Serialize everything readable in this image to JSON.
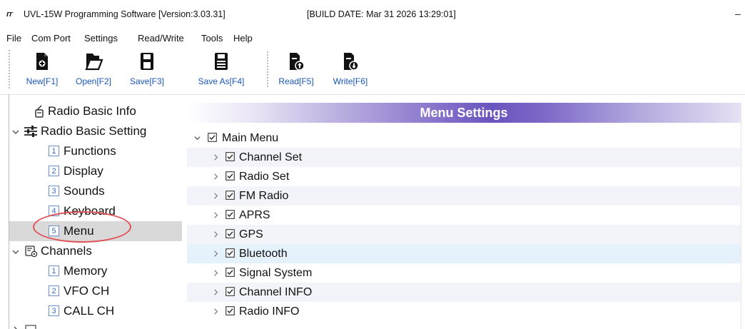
{
  "window": {
    "logo_text": "ᴦᴦ",
    "title": "UVL-15W Programming Software [Version:3.03.31]",
    "build": "[BUILD DATE: Mar 31 2026  13:29:01]",
    "minimize_glyph": "–"
  },
  "menubar": [
    "File",
    "Com Port",
    "Settings",
    "Read/Write",
    "Tools",
    "Help"
  ],
  "toolbar": {
    "new": "New[F1]",
    "open": "Open[F2]",
    "save": "Save[F3]",
    "save_as": "Save As[F4]",
    "read": "Read[F5]",
    "write": "Write[F6]"
  },
  "tree": {
    "basic_info": "Radio Basic Info",
    "basic_setting": "Radio Basic Setting",
    "functions": {
      "num": "1",
      "label": "Functions"
    },
    "display": {
      "num": "2",
      "label": "Display"
    },
    "sounds": {
      "num": "3",
      "label": "Sounds"
    },
    "keyboard": {
      "num": "4",
      "label": "Keyboard"
    },
    "menu": {
      "num": "5",
      "label": "Menu"
    },
    "channels": "Channels",
    "memory": {
      "num": "1",
      "label": "Memory"
    },
    "vfo": {
      "num": "2",
      "label": "VFO CH"
    },
    "call": {
      "num": "3",
      "label": "CALL CH"
    },
    "selected": "Menu"
  },
  "panel": {
    "title": "Menu Settings",
    "root": "Main Menu",
    "items": [
      "Channel Set",
      "Radio Set",
      "FM Radio",
      "APRS",
      "GPS",
      "Bluetooth",
      "Signal System",
      "Channel INFO",
      "Radio INFO"
    ]
  },
  "colors": {
    "toolbar_label": "#1a56b8",
    "header_purple": "#6a54be",
    "annotation_red": "#e05158",
    "selected_row": "#d9d9d9"
  }
}
